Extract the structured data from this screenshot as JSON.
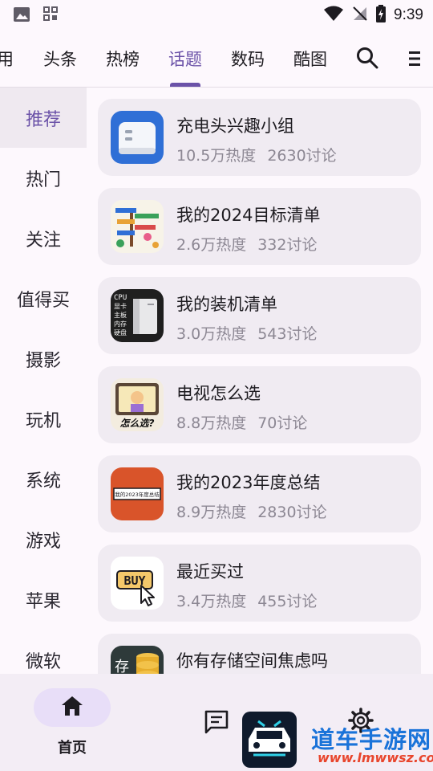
{
  "status_bar": {
    "time": "9:39"
  },
  "top_tabs": [
    {
      "label": "用",
      "active": false
    },
    {
      "label": "头条",
      "active": false
    },
    {
      "label": "热榜",
      "active": false
    },
    {
      "label": "话题",
      "active": true
    },
    {
      "label": "数码",
      "active": false
    },
    {
      "label": "酷图",
      "active": false
    }
  ],
  "sidebar": {
    "items": [
      {
        "label": "推荐",
        "active": true
      },
      {
        "label": "热门",
        "active": false
      },
      {
        "label": "关注",
        "active": false
      },
      {
        "label": "值得买",
        "active": false
      },
      {
        "label": "摄影",
        "active": false
      },
      {
        "label": "玩机",
        "active": false
      },
      {
        "label": "系统",
        "active": false
      },
      {
        "label": "游戏",
        "active": false
      },
      {
        "label": "苹果",
        "active": false
      },
      {
        "label": "微软",
        "active": false
      }
    ]
  },
  "topics": [
    {
      "title": "充电头兴趣小组",
      "heat": "10.5万热度",
      "discussions": "2630讨论",
      "icon": "charger-thumbnail"
    },
    {
      "title": "我的2024目标清单",
      "heat": "2.6万热度",
      "discussions": "332讨论",
      "icon": "goals-thumbnail"
    },
    {
      "title": "我的装机清单",
      "heat": "3.0万热度",
      "discussions": "543讨论",
      "icon": "pc-build-thumbnail",
      "thumb_text": "CPU\n显卡\n主板\n内存\n硬盘"
    },
    {
      "title": "电视怎么选",
      "heat": "8.8万热度",
      "discussions": "70讨论",
      "icon": "tv-thumbnail",
      "thumb_text": "怎么选?"
    },
    {
      "title": "我的2023年度总结",
      "heat": "8.9万热度",
      "discussions": "2830讨论",
      "icon": "summary-thumbnail",
      "thumb_text": "我的2023年度总结"
    },
    {
      "title": "最近买过",
      "heat": "3.4万热度",
      "discussions": "455讨论",
      "icon": "buy-thumbnail",
      "thumb_text": "BUY"
    },
    {
      "title": "你有存储空间焦虑吗",
      "heat": "",
      "discussions": "",
      "icon": "storage-thumbnail",
      "thumb_text": "存"
    }
  ],
  "bottom_nav": {
    "home_label": "首页"
  },
  "watermark": {
    "cn": "道车手游网",
    "url": "www.lmwwsz.com"
  },
  "colors": {
    "accent": "#6b52a8",
    "card": "#f0ebf2",
    "background": "#fdf8fd",
    "meta_text": "#8c8793"
  }
}
